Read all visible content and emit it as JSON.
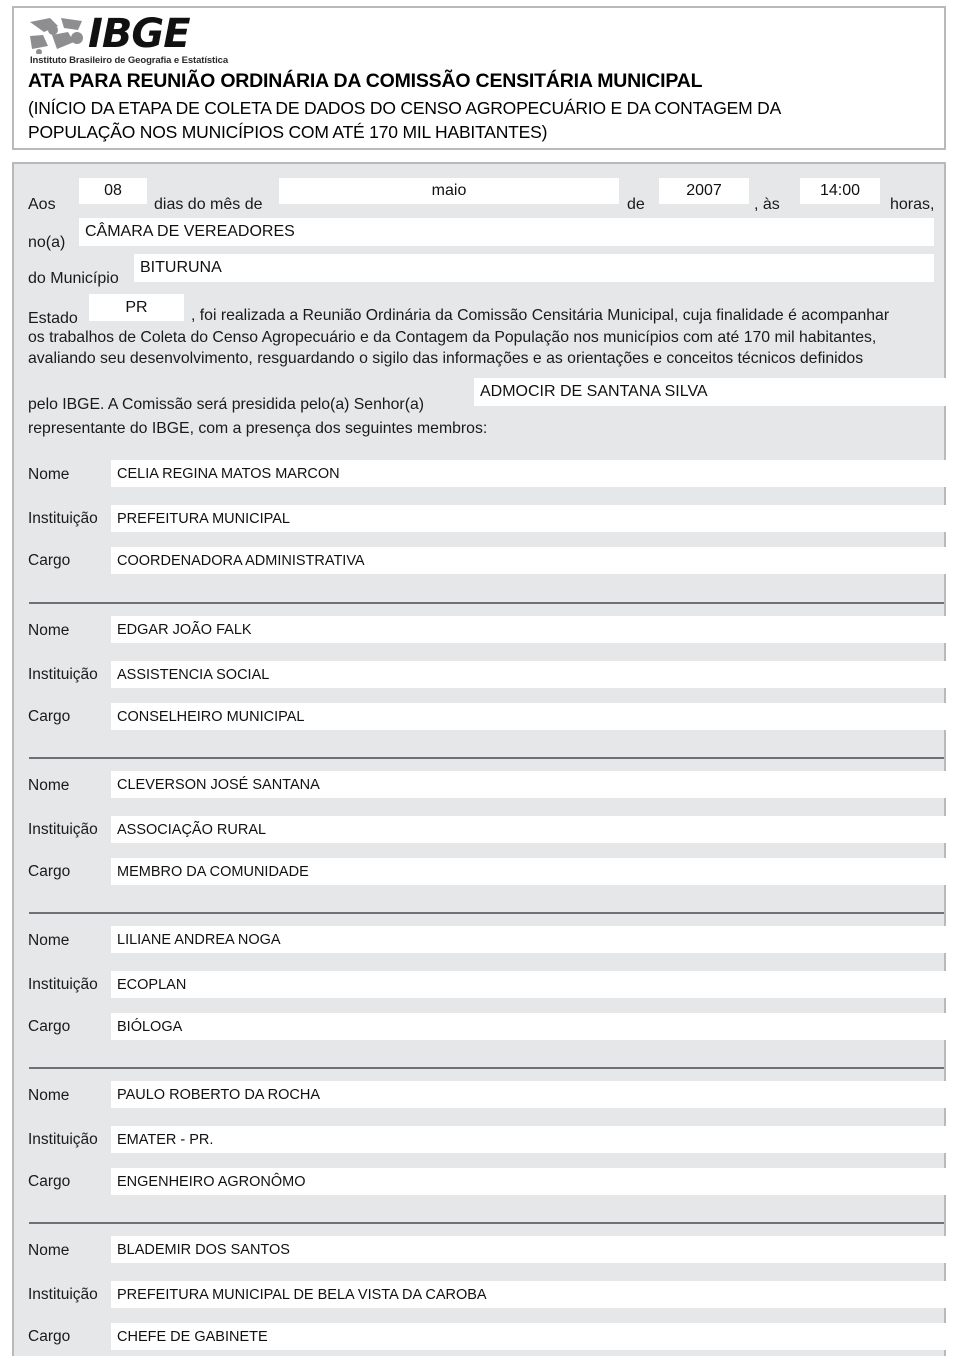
{
  "header": {
    "logo_word": "IBGE",
    "logo_subtitle": "Instituto Brasileiro de Geografia e Estatística",
    "title_main": "ATA PARA REUNIÃO ORDINÁRIA DA COMISSÃO CENSITÁRIA MUNICIPAL",
    "title_sub_line1": "(INÍCIO DA ETAPA DE COLETA DE DADOS DO CENSO AGROPECUÁRIO E DA CONTAGEM DA",
    "title_sub_line2": "POPULAÇÃO NOS MUNICÍPIOS COM ATÉ 170 MIL HABITANTES)"
  },
  "form": {
    "label_aos": "Aos",
    "day_value": "08",
    "label_dias_do_mes_de": "dias do mês de",
    "month_value": "maio",
    "label_de": "de",
    "year_value": "2007",
    "label_as": ", às",
    "time_value": "14:00",
    "label_horas": "horas,",
    "label_noa": "no(a)",
    "local_value": "CÂMARA DE VEREADORES",
    "label_municipio": "do Município",
    "municipio_value": "BITURUNA",
    "label_estado": "Estado",
    "uf_value": "PR",
    "paragraph_line1": ", foi realizada a Reunião Ordinária da Comissão Censitária Municipal, cuja finalidade é acompanhar",
    "paragraph_line2": "os trabalhos de Coleta do Censo Agropecuário e da Contagem da População nos municípios com até 170 mil habitantes,",
    "paragraph_line3": "avaliando seu desenvolvimento, resguardando o sigilo das informações e as orientações e conceitos técnicos definidos",
    "label_pelo_ibge": "pelo IBGE. A Comissão será presidida pelo(a) Senhor(a)",
    "president_value": "ADMOCIR DE SANTANA SILVA",
    "label_trailing_comma": ",",
    "label_representante": "representante do IBGE, com a presença dos seguintes membros:"
  },
  "member_labels": {
    "nome": "Nome",
    "instituicao": "Instituição",
    "cargo": "Cargo"
  },
  "members": [
    {
      "nome": "CELIA REGINA MATOS MARCON",
      "instituicao": "PREFEITURA MUNICIPAL",
      "cargo": "COORDENADORA ADMINISTRATIVA"
    },
    {
      "nome": "EDGAR JOÃO FALK",
      "instituicao": "ASSISTENCIA SOCIAL",
      "cargo": "CONSELHEIRO MUNICIPAL"
    },
    {
      "nome": "CLEVERSON JOSÉ SANTANA",
      "instituicao": "ASSOCIAÇÃO RURAL",
      "cargo": "MEMBRO DA COMUNIDADE"
    },
    {
      "nome": "LILIANE ANDREA NOGA",
      "instituicao": "ECOPLAN",
      "cargo": "BIÓLOGA"
    },
    {
      "nome": "PAULO ROBERTO DA ROCHA",
      "instituicao": "EMATER - PR.",
      "cargo": "ENGENHEIRO AGRONÔMO"
    },
    {
      "nome": "BLADEMIR DOS SANTOS",
      "instituicao": "PREFEITURA MUNICIPAL DE BELA VISTA DA CAROBA",
      "cargo": "CHEFE DE GABINETE"
    }
  ],
  "colors": {
    "page_background": "#ffffff",
    "form_background": "#e6e7e9",
    "field_background": "#ffffff",
    "border": "#b9b9b9",
    "divider": "#6f6f75",
    "text": "#1a1a1a"
  }
}
